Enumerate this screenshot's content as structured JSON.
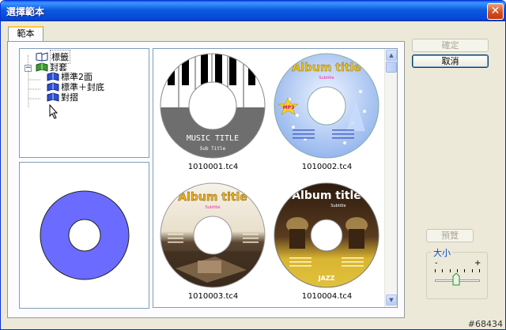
{
  "window": {
    "title": "選擇範本",
    "close_symbol": "✕"
  },
  "tabs": [
    {
      "label": "範本"
    }
  ],
  "tree": {
    "toggle_symbol": "−",
    "items": [
      {
        "label": "標籤",
        "icon": "book-label-icon",
        "selected": true
      },
      {
        "label": "封套",
        "icon": "book-green-icon"
      },
      {
        "label": "標準2面",
        "icon": "book-blue-icon"
      },
      {
        "label": "標準＋封底",
        "icon": "book-blue-icon"
      },
      {
        "label": "對摺",
        "icon": "book-blue-icon"
      }
    ]
  },
  "preview": {
    "disc_color": "#6b6bff"
  },
  "gallery": {
    "items": [
      {
        "filename": "1010001.tc4",
        "title": "MUSIC TITLE",
        "subtitle": "Sub Title"
      },
      {
        "filename": "1010002.tc4",
        "title": "Album title",
        "subtitle": "Subtitle",
        "badge": "MP3"
      },
      {
        "filename": "1010003.tc4",
        "title": "Album title",
        "subtitle": "Subtitle"
      },
      {
        "filename": "1010004.tc4",
        "title": "Album title",
        "subtitle": "Subtitle",
        "footer": "JAZZ"
      }
    ]
  },
  "buttons": {
    "ok": "確定",
    "cancel": "取消",
    "preview": "預覽"
  },
  "size": {
    "label": "大小",
    "minus": "-",
    "plus": "+",
    "value": 0.5
  },
  "watermark": "#68434",
  "colors": {
    "accent": "#0a5fe8",
    "disc_preview": "#6b6bff"
  }
}
